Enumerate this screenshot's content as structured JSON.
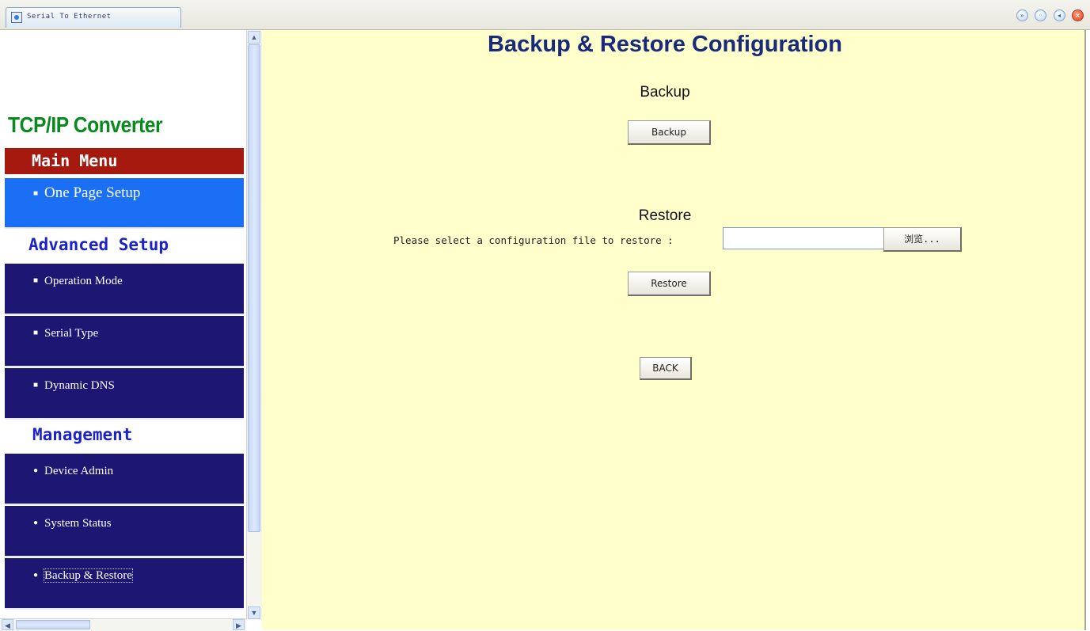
{
  "window": {
    "tab_title": "Serial To Ethernet",
    "controls": [
      "forward-icon",
      "info-icon",
      "back-icon",
      "close-icon"
    ]
  },
  "sidebar": {
    "brand": "TCP/IP Converter",
    "main_menu_header": "Main Menu",
    "main_items": [
      {
        "label": "One Page Setup"
      }
    ],
    "advanced_header": "Advanced Setup",
    "advanced_items": [
      {
        "label": "Operation Mode"
      },
      {
        "label": "Serial Type"
      },
      {
        "label": "Dynamic DNS"
      }
    ],
    "management_header": "Management",
    "management_items": [
      {
        "label": "Device Admin"
      },
      {
        "label": "System Status"
      },
      {
        "label": "Backup & Restore"
      }
    ]
  },
  "main": {
    "title": "Backup & Restore Configuration",
    "backup": {
      "heading": "Backup",
      "button_label": "Backup"
    },
    "restore": {
      "heading": "Restore",
      "file_label": "Please select a configuration file to restore :",
      "file_value": "",
      "browse_label": "浏览...",
      "button_label": "Restore"
    },
    "back_label": "BACK"
  },
  "colors": {
    "page_background": "#ffffcc",
    "title_color": "#1a2a7a",
    "brand_color": "#0a8a1e",
    "main_menu_header_bg": "#a5190f",
    "section_header_color": "#1a22c8",
    "active_item_bg": "#1a6ff5",
    "item_bg": "#1d1672"
  }
}
